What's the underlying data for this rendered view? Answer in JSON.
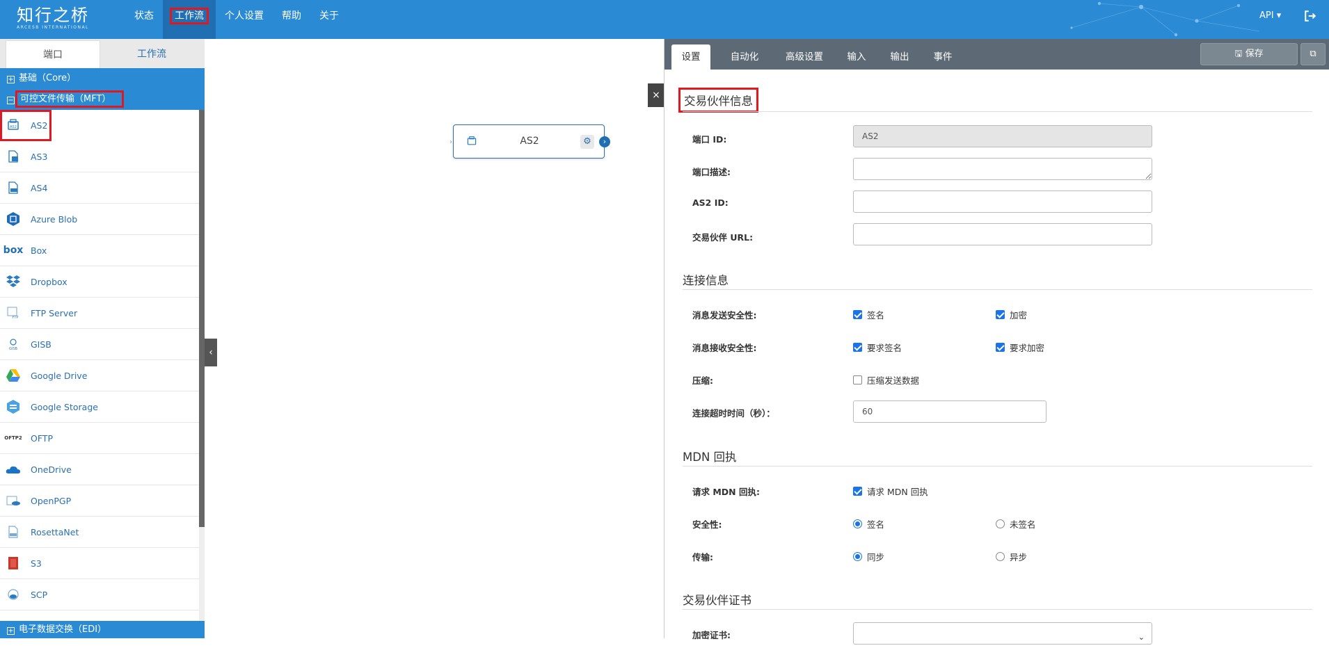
{
  "app": {
    "logo_text": "知行之桥",
    "logo_subtext": "ARCESB INTERNATIONAL"
  },
  "nav": {
    "items": [
      {
        "label": "状态"
      },
      {
        "label": "工作流"
      },
      {
        "label": "个人设置"
      },
      {
        "label": "帮助"
      },
      {
        "label": "关于"
      }
    ],
    "active": "工作流",
    "api_label": "API ▾"
  },
  "sidebar": {
    "tabs": [
      {
        "label": "端口"
      },
      {
        "label": "工作流"
      }
    ],
    "groups": [
      {
        "label": "基础（Core）",
        "expanded": false
      },
      {
        "label": "可控文件传输（MFT）",
        "expanded": true
      },
      {
        "label": "电子数据交换（EDI）",
        "expanded": false
      }
    ],
    "connectors": [
      {
        "label": "AS2",
        "icon": "as2-icon"
      },
      {
        "label": "AS3",
        "icon": "as3-icon"
      },
      {
        "label": "AS4",
        "icon": "as4-icon"
      },
      {
        "label": "Azure Blob",
        "icon": "azure-blob-icon"
      },
      {
        "label": "Box",
        "icon": "box-icon"
      },
      {
        "label": "Dropbox",
        "icon": "dropbox-icon"
      },
      {
        "label": "FTP Server",
        "icon": "ftp-server-icon"
      },
      {
        "label": "GISB",
        "icon": "gisb-icon"
      },
      {
        "label": "Google Drive",
        "icon": "google-drive-icon"
      },
      {
        "label": "Google Storage",
        "icon": "google-storage-icon"
      },
      {
        "label": "OFTP",
        "icon": "oftp-icon"
      },
      {
        "label": "OneDrive",
        "icon": "onedrive-icon"
      },
      {
        "label": "OpenPGP",
        "icon": "openpgp-icon"
      },
      {
        "label": "RosettaNet",
        "icon": "rosettanet-icon"
      },
      {
        "label": "S3",
        "icon": "s3-icon"
      },
      {
        "label": "SCP",
        "icon": "scp-icon"
      }
    ],
    "icon_text": {
      "box": "box",
      "oftp": "OFTP2",
      "gisb": "GISB",
      "ftp": "FTP"
    }
  },
  "canvas": {
    "node_label": "AS2"
  },
  "panel": {
    "tabs": [
      {
        "label": "设置"
      },
      {
        "label": "自动化"
      },
      {
        "label": "高级设置"
      },
      {
        "label": "输入"
      },
      {
        "label": "输出"
      },
      {
        "label": "事件"
      }
    ],
    "save_label": "保存",
    "sections": {
      "partner_info": "交易伙伴信息",
      "connection_info": "连接信息",
      "mdn": "MDN 回执",
      "partner_cert": "交易伙伴证书"
    },
    "fields": {
      "port_id": {
        "label": "端口 ID:",
        "value": "AS2"
      },
      "port_desc": {
        "label": "端口描述:",
        "value": ""
      },
      "as2_id": {
        "label": "AS2 ID:",
        "value": ""
      },
      "partner_url": {
        "label": "交易伙伴 URL:",
        "value": ""
      },
      "send_security": {
        "label": "消息发送安全性:",
        "opt1": "签名",
        "opt1_checked": true,
        "opt2": "加密",
        "opt2_checked": true
      },
      "recv_security": {
        "label": "消息接收安全性:",
        "opt1": "要求签名",
        "opt1_checked": true,
        "opt2": "要求加密",
        "opt2_checked": true
      },
      "compression": {
        "label": "压缩:",
        "opt1": "压缩发送数据",
        "opt1_checked": false
      },
      "timeout": {
        "label": "连接超时时间（秒）：",
        "value": "60"
      },
      "request_mdn": {
        "label": "请求 MDN 回执:",
        "opt1": "请求 MDN 回执",
        "opt1_checked": true
      },
      "security": {
        "label": "安全性:",
        "opt1": "签名",
        "opt2": "未签名",
        "selected": "签名"
      },
      "delivery": {
        "label": "传输:",
        "opt1": "同步",
        "opt2": "异步",
        "selected": "同步"
      },
      "encrypt_cert": {
        "label": "加密证书:",
        "value": ""
      }
    }
  },
  "colors": {
    "topbar": "#2a8ad4",
    "accent": "#1f6fb2",
    "highlight": "#e0181f",
    "panel_tabs": "#5d6a75"
  }
}
